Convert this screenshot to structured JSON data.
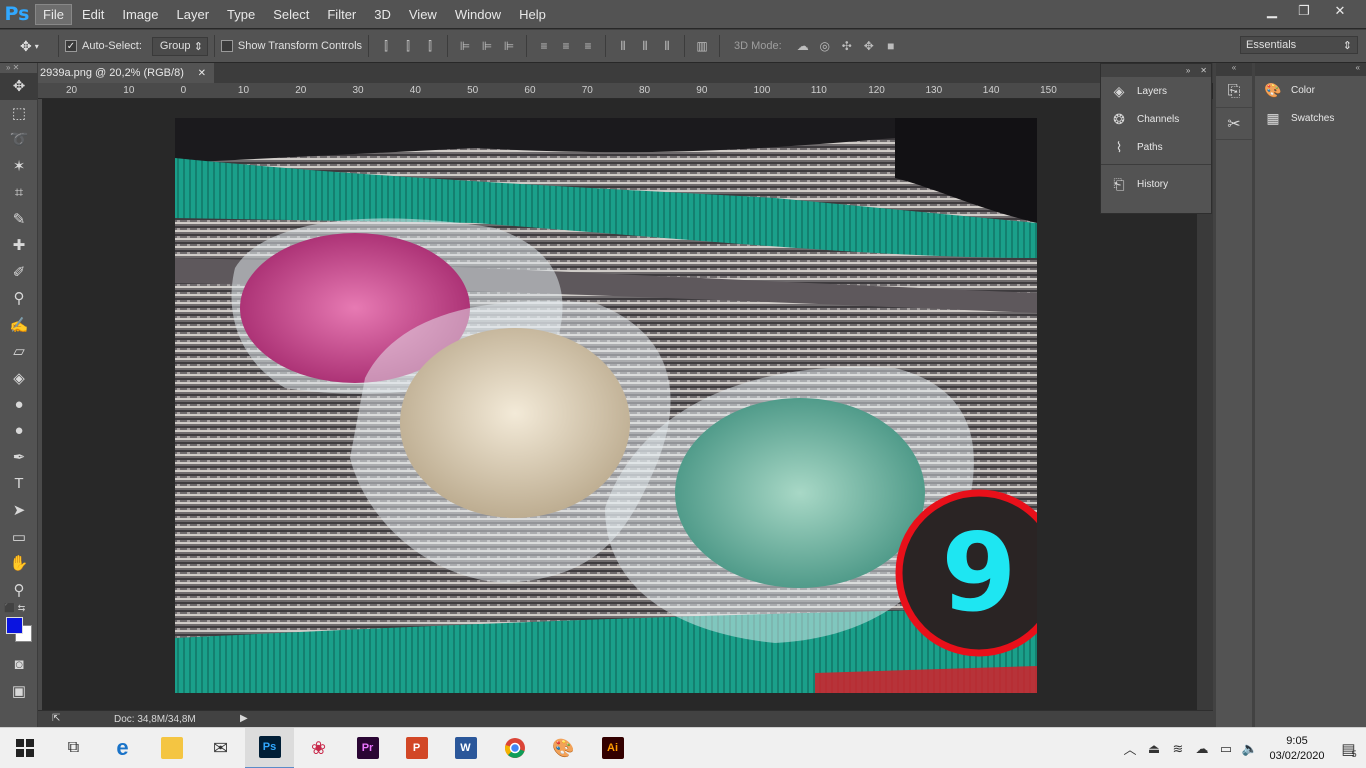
{
  "app": {
    "logo": "Ps"
  },
  "menu": [
    "File",
    "Edit",
    "Image",
    "Layer",
    "Type",
    "Select",
    "Filter",
    "3D",
    "View",
    "Window",
    "Help"
  ],
  "window_controls": {
    "minimize": "▁",
    "restore": "❐",
    "close": "✕"
  },
  "options_bar": {
    "auto_select_label": "Auto-Select:",
    "auto_select_checked": "✓",
    "auto_select_value": "Group",
    "show_transform_label": "Show Transform Controls",
    "mode_label": "3D Mode:",
    "workspace": "Essentials"
  },
  "document": {
    "tab_title": "2939a.png @ 20,2% (RGB/8)",
    "close": "✕",
    "status": "Doc: 34,8M/34,8M",
    "overlay_number": "9",
    "ruler_ticks": [
      "20",
      "10",
      "0",
      "10",
      "20",
      "30",
      "40",
      "50",
      "60",
      "70",
      "80",
      "90",
      "100",
      "110",
      "120",
      "130",
      "140",
      "150"
    ]
  },
  "panels": {
    "group1": [
      {
        "label": "Layers",
        "icon": "layers-icon"
      },
      {
        "label": "Channels",
        "icon": "channels-icon"
      },
      {
        "label": "Paths",
        "icon": "paths-icon"
      }
    ],
    "group2": [
      {
        "label": "History",
        "icon": "history-icon"
      }
    ],
    "group3": [
      {
        "label": "Color",
        "icon": "palette-icon"
      },
      {
        "label": "Swatches",
        "icon": "swatches-icon"
      }
    ]
  },
  "colors": {
    "foreground": "#0a14e0",
    "background": "#ffffff",
    "ps_accent": "#31a8ff",
    "overlay_ring": "#e8101a",
    "overlay_digit": "#1ee6f2"
  },
  "taskbar": {
    "apps": [
      {
        "name": "file-explorer",
        "label": ""
      },
      {
        "name": "mail",
        "label": ""
      },
      {
        "name": "photoshop",
        "label": "Ps"
      },
      {
        "name": "corel",
        "label": ""
      },
      {
        "name": "premiere",
        "label": "Pr"
      },
      {
        "name": "powerpoint",
        "label": "P"
      },
      {
        "name": "word",
        "label": "W"
      },
      {
        "name": "chrome",
        "label": ""
      },
      {
        "name": "paint",
        "label": ""
      },
      {
        "name": "illustrator",
        "label": "Ai"
      }
    ],
    "time": "9:05",
    "date": "03/02/2020",
    "notifications": "5"
  }
}
